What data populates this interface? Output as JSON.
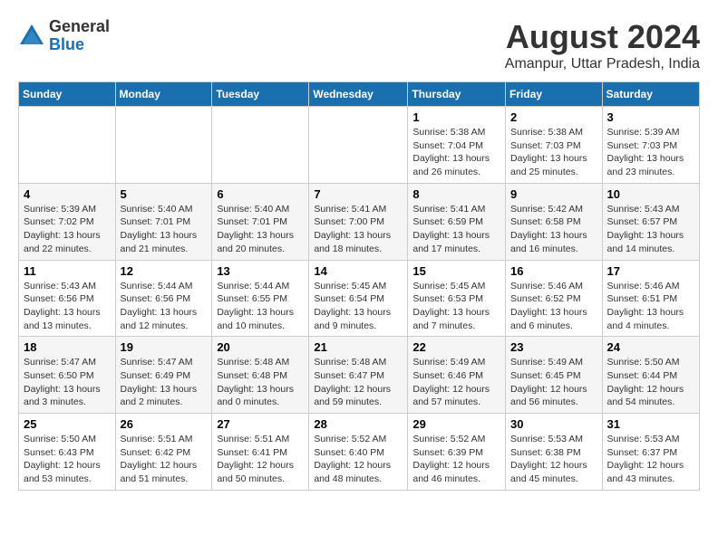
{
  "logo": {
    "general": "General",
    "blue": "Blue"
  },
  "title": "August 2024",
  "location": "Amanpur, Uttar Pradesh, India",
  "weekdays": [
    "Sunday",
    "Monday",
    "Tuesday",
    "Wednesday",
    "Thursday",
    "Friday",
    "Saturday"
  ],
  "weeks": [
    [
      {
        "day": "",
        "info": ""
      },
      {
        "day": "",
        "info": ""
      },
      {
        "day": "",
        "info": ""
      },
      {
        "day": "",
        "info": ""
      },
      {
        "day": "1",
        "info": "Sunrise: 5:38 AM\nSunset: 7:04 PM\nDaylight: 13 hours\nand 26 minutes."
      },
      {
        "day": "2",
        "info": "Sunrise: 5:38 AM\nSunset: 7:03 PM\nDaylight: 13 hours\nand 25 minutes."
      },
      {
        "day": "3",
        "info": "Sunrise: 5:39 AM\nSunset: 7:03 PM\nDaylight: 13 hours\nand 23 minutes."
      }
    ],
    [
      {
        "day": "4",
        "info": "Sunrise: 5:39 AM\nSunset: 7:02 PM\nDaylight: 13 hours\nand 22 minutes."
      },
      {
        "day": "5",
        "info": "Sunrise: 5:40 AM\nSunset: 7:01 PM\nDaylight: 13 hours\nand 21 minutes."
      },
      {
        "day": "6",
        "info": "Sunrise: 5:40 AM\nSunset: 7:01 PM\nDaylight: 13 hours\nand 20 minutes."
      },
      {
        "day": "7",
        "info": "Sunrise: 5:41 AM\nSunset: 7:00 PM\nDaylight: 13 hours\nand 18 minutes."
      },
      {
        "day": "8",
        "info": "Sunrise: 5:41 AM\nSunset: 6:59 PM\nDaylight: 13 hours\nand 17 minutes."
      },
      {
        "day": "9",
        "info": "Sunrise: 5:42 AM\nSunset: 6:58 PM\nDaylight: 13 hours\nand 16 minutes."
      },
      {
        "day": "10",
        "info": "Sunrise: 5:43 AM\nSunset: 6:57 PM\nDaylight: 13 hours\nand 14 minutes."
      }
    ],
    [
      {
        "day": "11",
        "info": "Sunrise: 5:43 AM\nSunset: 6:56 PM\nDaylight: 13 hours\nand 13 minutes."
      },
      {
        "day": "12",
        "info": "Sunrise: 5:44 AM\nSunset: 6:56 PM\nDaylight: 13 hours\nand 12 minutes."
      },
      {
        "day": "13",
        "info": "Sunrise: 5:44 AM\nSunset: 6:55 PM\nDaylight: 13 hours\nand 10 minutes."
      },
      {
        "day": "14",
        "info": "Sunrise: 5:45 AM\nSunset: 6:54 PM\nDaylight: 13 hours\nand 9 minutes."
      },
      {
        "day": "15",
        "info": "Sunrise: 5:45 AM\nSunset: 6:53 PM\nDaylight: 13 hours\nand 7 minutes."
      },
      {
        "day": "16",
        "info": "Sunrise: 5:46 AM\nSunset: 6:52 PM\nDaylight: 13 hours\nand 6 minutes."
      },
      {
        "day": "17",
        "info": "Sunrise: 5:46 AM\nSunset: 6:51 PM\nDaylight: 13 hours\nand 4 minutes."
      }
    ],
    [
      {
        "day": "18",
        "info": "Sunrise: 5:47 AM\nSunset: 6:50 PM\nDaylight: 13 hours\nand 3 minutes."
      },
      {
        "day": "19",
        "info": "Sunrise: 5:47 AM\nSunset: 6:49 PM\nDaylight: 13 hours\nand 2 minutes."
      },
      {
        "day": "20",
        "info": "Sunrise: 5:48 AM\nSunset: 6:48 PM\nDaylight: 13 hours\nand 0 minutes."
      },
      {
        "day": "21",
        "info": "Sunrise: 5:48 AM\nSunset: 6:47 PM\nDaylight: 12 hours\nand 59 minutes."
      },
      {
        "day": "22",
        "info": "Sunrise: 5:49 AM\nSunset: 6:46 PM\nDaylight: 12 hours\nand 57 minutes."
      },
      {
        "day": "23",
        "info": "Sunrise: 5:49 AM\nSunset: 6:45 PM\nDaylight: 12 hours\nand 56 minutes."
      },
      {
        "day": "24",
        "info": "Sunrise: 5:50 AM\nSunset: 6:44 PM\nDaylight: 12 hours\nand 54 minutes."
      }
    ],
    [
      {
        "day": "25",
        "info": "Sunrise: 5:50 AM\nSunset: 6:43 PM\nDaylight: 12 hours\nand 53 minutes."
      },
      {
        "day": "26",
        "info": "Sunrise: 5:51 AM\nSunset: 6:42 PM\nDaylight: 12 hours\nand 51 minutes."
      },
      {
        "day": "27",
        "info": "Sunrise: 5:51 AM\nSunset: 6:41 PM\nDaylight: 12 hours\nand 50 minutes."
      },
      {
        "day": "28",
        "info": "Sunrise: 5:52 AM\nSunset: 6:40 PM\nDaylight: 12 hours\nand 48 minutes."
      },
      {
        "day": "29",
        "info": "Sunrise: 5:52 AM\nSunset: 6:39 PM\nDaylight: 12 hours\nand 46 minutes."
      },
      {
        "day": "30",
        "info": "Sunrise: 5:53 AM\nSunset: 6:38 PM\nDaylight: 12 hours\nand 45 minutes."
      },
      {
        "day": "31",
        "info": "Sunrise: 5:53 AM\nSunset: 6:37 PM\nDaylight: 12 hours\nand 43 minutes."
      }
    ]
  ]
}
